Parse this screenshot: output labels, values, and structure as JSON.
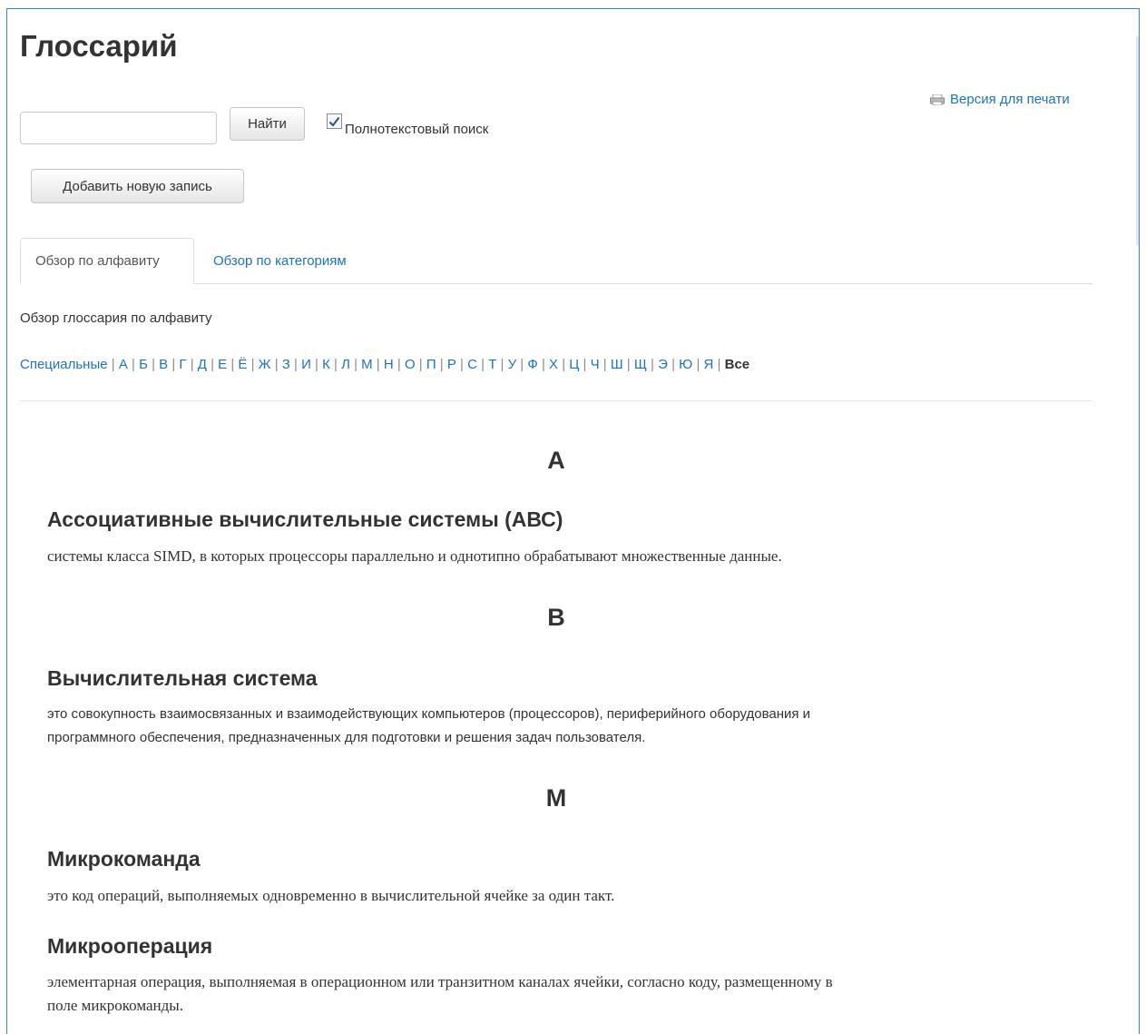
{
  "page": {
    "title": "Глоссарий",
    "print_link": "Версия для печати",
    "search_button": "Найти",
    "fulltext_label": "Полнотекстовый поиск",
    "fulltext_checked": true,
    "add_button": "Добавить новую запись",
    "tabs": [
      {
        "label": "Обзор по алфавиту",
        "active": true
      },
      {
        "label": "Обзор по категориям",
        "active": false
      }
    ],
    "browse_caption": "Обзор глоссария по алфавиту",
    "alphabet": [
      "Специальные",
      "А",
      "Б",
      "В",
      "Г",
      "Д",
      "Е",
      "Ё",
      "Ж",
      "З",
      "И",
      "К",
      "Л",
      "М",
      "Н",
      "О",
      "П",
      "Р",
      "С",
      "Т",
      "У",
      "Ф",
      "Х",
      "Ц",
      "Ч",
      "Ш",
      "Щ",
      "Э",
      "Ю",
      "Я"
    ],
    "alphabet_current": "Все"
  },
  "entries": {
    "letter_a": "А",
    "term_1": "Ассоциативные вычислительные системы (АВС)",
    "def_1": "системы класса SIMD, в которых процессоры параллельно и однотипно обрабатывают множественные данные.",
    "letter_b": "В",
    "term_2": "Вычислительная система",
    "def_2_line1": "это совокупность взаимосвязанных и взаимодействующих компьютеров (процессоров), периферийного оборудования и",
    "def_2_line2": "программного обеспечения, предназначенных для подготовки и решения задач пользователя.",
    "letter_m": "М",
    "term_3": "Микрокоманда",
    "def_3": "это код операций, выполняемых одновременно в вычислительной ячейке за один такт.",
    "term_4": "Микрооперация",
    "def_4_line1": "элементарная операция, выполняемая в операционном или транзитном каналах ячейки, согласно коду, размещенному в",
    "def_4_line2": "поле микрокоманды."
  },
  "colors": {
    "link": "#1e73b9",
    "text": "#333333",
    "frame_border": "#3b82d6"
  },
  "icons": {
    "print": "printer-icon",
    "checkbox": "checkmark-icon"
  }
}
